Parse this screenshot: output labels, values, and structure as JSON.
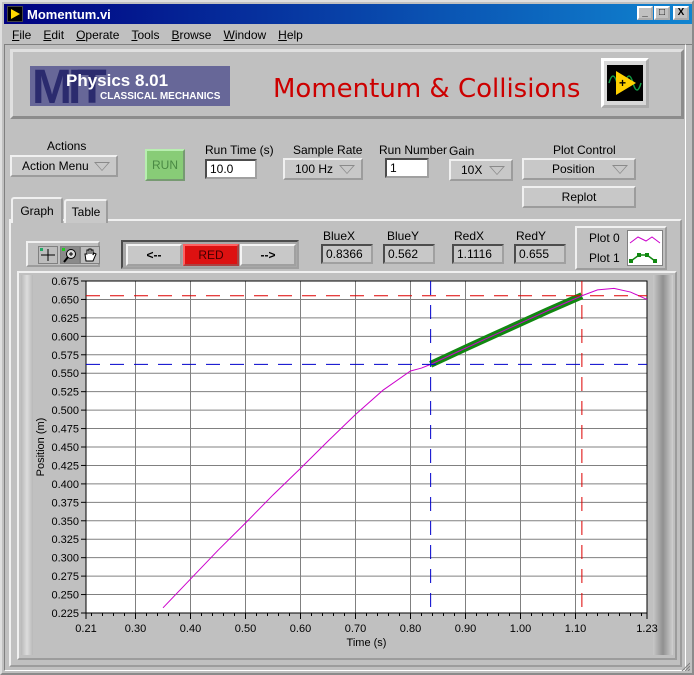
{
  "window": {
    "title": "Momentum.vi",
    "controls": {
      "minimize": "_",
      "maximize": "□",
      "close": "X"
    }
  },
  "menubar": [
    "File",
    "Edit",
    "Operate",
    "Tools",
    "Browse",
    "Window",
    "Help"
  ],
  "banner": {
    "logo_mit": "MIT",
    "logo_course": "Physics 8.01",
    "logo_subtitle": "CLASSICAL MECHANICS",
    "title": "Momentum & Collisions",
    "icon": "labview-vi-icon"
  },
  "controls": {
    "actions_label": "Actions",
    "actions_value": "Action Menu",
    "run_label": "RUN",
    "run_time_label": "Run Time (s)",
    "run_time_value": "10.0",
    "sample_rate_label": "Sample Rate",
    "sample_rate_value": "100 Hz",
    "run_number_label": "Run Number",
    "run_number_value": "1",
    "gain_label": "Gain",
    "gain_value": "10X",
    "plot_control_label": "Plot Control",
    "plot_control_value": "Position",
    "replot_label": "Replot"
  },
  "tabs": [
    {
      "label": "Graph",
      "active": true
    },
    {
      "label": "Table",
      "active": false
    }
  ],
  "graph_tools": {
    "tools": [
      "crosshair-icon",
      "zoom-icon",
      "pan-hand-icon"
    ],
    "selected": "zoom-icon",
    "cursor_prev": "<--",
    "cursor_active": "RED",
    "cursor_next": "-->"
  },
  "readouts": {
    "bluex_label": "BlueX",
    "bluex_value": "0.8366",
    "bluey_label": "BlueY",
    "bluey_value": "0.562",
    "redx_label": "RedX",
    "redx_value": "1.1116",
    "redy_label": "RedY",
    "redy_value": "0.655"
  },
  "legend": {
    "plot0": "Plot 0",
    "plot1": "Plot 1"
  },
  "colors": {
    "plot0": "#cc00cc",
    "plot1": "#118811",
    "blue_cursor": "#0000cc",
    "red_cursor": "#dd0000",
    "grid": "#808080"
  },
  "chart_data": {
    "type": "line",
    "title": "",
    "xlabel": "Time (s)",
    "ylabel": "Position (m)",
    "xlim": [
      0.21,
      1.23
    ],
    "ylim": [
      0.225,
      0.675
    ],
    "xticks": [
      "0.21",
      "0.30",
      "0.40",
      "0.50",
      "0.60",
      "0.70",
      "0.80",
      "0.90",
      "1.00",
      "1.10",
      "1.23"
    ],
    "xtick_values": [
      0.21,
      0.3,
      0.4,
      0.5,
      0.6,
      0.7,
      0.8,
      0.9,
      1.0,
      1.1,
      1.23
    ],
    "yticks": [
      "0.225",
      "0.250",
      "0.275",
      "0.300",
      "0.325",
      "0.350",
      "0.375",
      "0.400",
      "0.425",
      "0.450",
      "0.475",
      "0.500",
      "0.525",
      "0.550",
      "0.575",
      "0.600",
      "0.625",
      "0.650",
      "0.675"
    ],
    "grid": true,
    "legend": "top-right",
    "series": [
      {
        "name": "Plot 0",
        "x": [
          0.35,
          0.4,
          0.45,
          0.5,
          0.55,
          0.6,
          0.65,
          0.7,
          0.75,
          0.8,
          0.82,
          0.8366,
          0.9,
          0.95,
          1.0,
          1.05,
          1.1116,
          1.14,
          1.17,
          1.2,
          1.23
        ],
        "y": [
          0.232,
          0.271,
          0.31,
          0.347,
          0.385,
          0.421,
          0.458,
          0.494,
          0.527,
          0.553,
          0.557,
          0.562,
          0.584,
          0.601,
          0.618,
          0.635,
          0.655,
          0.663,
          0.665,
          0.66,
          0.65
        ]
      },
      {
        "name": "Plot 1",
        "x": [
          0.8366,
          0.9,
          0.95,
          1.0,
          1.05,
          1.1116
        ],
        "y": [
          0.562,
          0.584,
          0.601,
          0.618,
          0.635,
          0.655
        ]
      }
    ],
    "cursors": [
      {
        "name": "Blue",
        "x": 0.8366,
        "y": 0.562
      },
      {
        "name": "Red",
        "x": 1.1116,
        "y": 0.655
      }
    ]
  }
}
